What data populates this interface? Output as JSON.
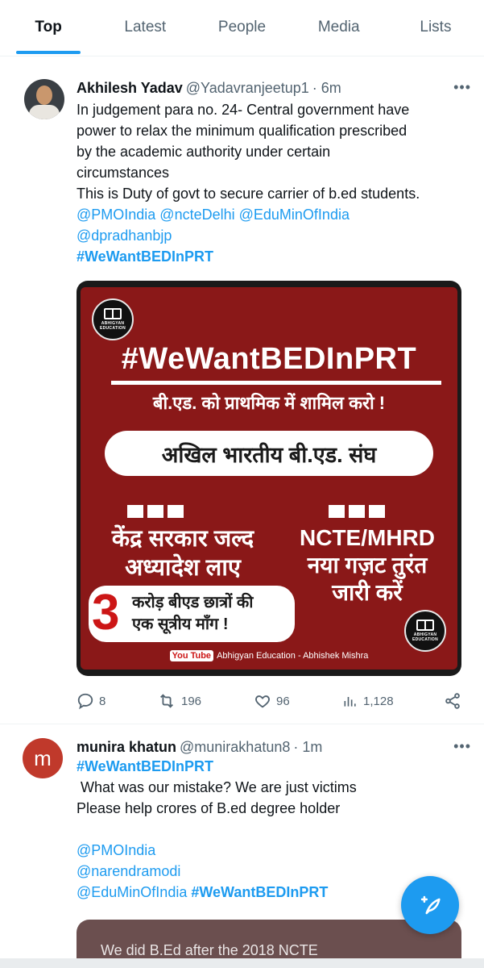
{
  "tabs": [
    {
      "label": "Top",
      "active": true
    },
    {
      "label": "Latest"
    },
    {
      "label": "People"
    },
    {
      "label": "Media"
    },
    {
      "label": "Lists"
    }
  ],
  "tweet1": {
    "name": "Akhilesh Yadav",
    "handle": "@Yadavranjeetup1",
    "time": "· 6m",
    "more": "•••",
    "lines": [
      "In judgement para no. 24- Central government have",
      "power to relax the minimum qualification prescribed",
      "by the academic authority under certain",
      "circumstances",
      "This is Duty of govt to secure carrier of b.ed students."
    ],
    "mentions_line1": "@PMOIndia @ncteDelhi  @EduMinOfIndia",
    "mentions_line2": "@dpradhanbjp",
    "hashtag": "#WeWantBEDInPRT",
    "poster": {
      "logo_text": "ABHIGYAN EDUCATION",
      "title": "#WeWantBEDInPRT",
      "subtitle": "बी.एड. को प्राथमिक में शामिल करो !",
      "pill": "अखिल भारतीय बी.एड. संघ",
      "left_line1": "केंद्र सरकार जल्द",
      "left_line2": "अध्यादेश लाए",
      "right_line1": "NCTE/MHRD",
      "right_line2": "नया गज़ट तुरंत",
      "right_line3": "जारी करें",
      "card_number": "3",
      "card_line1": "करोड़ बीएड छात्रों की",
      "card_line2": "एक सूत्रीय माँग !",
      "youtube": "You Tube",
      "footer": "Abhigyan Education - Abhishek Mishra"
    },
    "stats": {
      "replies": "8",
      "retweets": "196",
      "likes": "96",
      "views": "1,128"
    }
  },
  "tweet2": {
    "avatar_letter": "m",
    "name": "munira khatun",
    "handle": "@munirakhatun8",
    "time": "· 1m",
    "more": "•••",
    "hashtag": "#WeWantBEDInPRT",
    "line1": " What was our mistake? We are just victims",
    "line2": "Please help crores of B.ed degree holder",
    "mention1": "@PMOIndia",
    "mention2": "@narendramodi",
    "mention3": "@EduMinOfIndia",
    "hashtag2": "#WeWantBEDInPRT",
    "preview_text": "We did B.Ed after the 2018 NCTE"
  },
  "colors": {
    "accent": "#1d9bf0",
    "poster_red": "#8a1818"
  }
}
